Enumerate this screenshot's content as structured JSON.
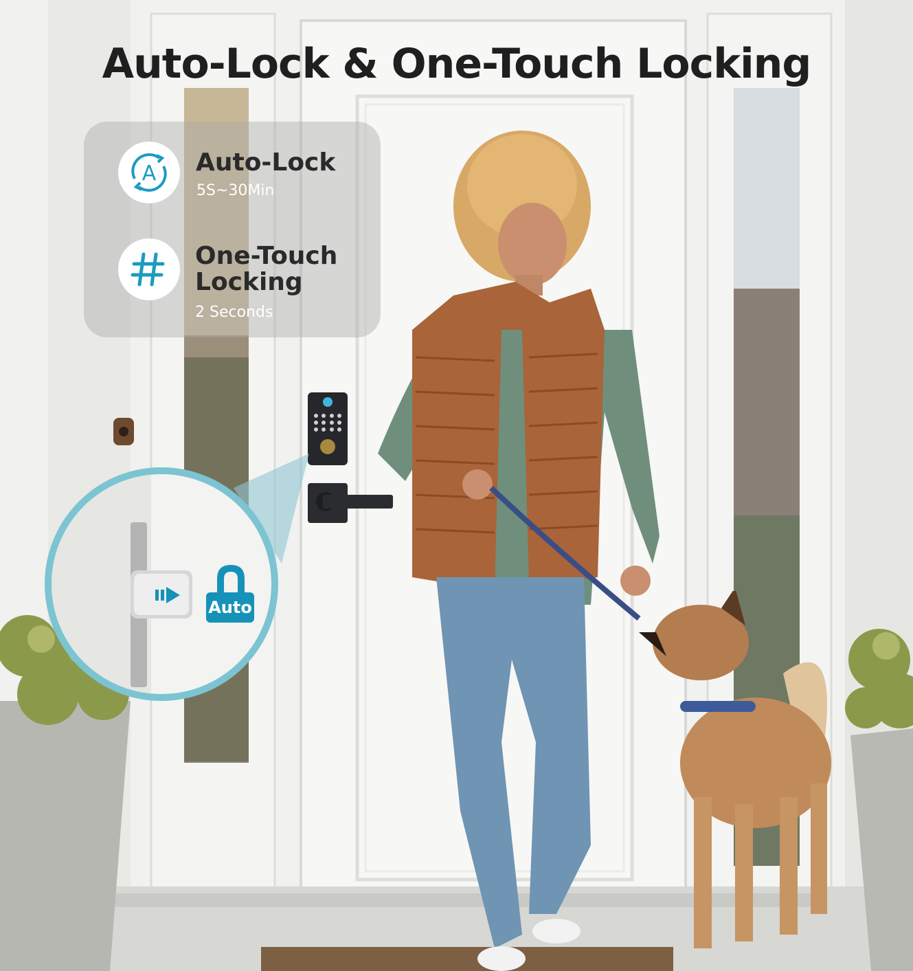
{
  "title": "Auto-Lock & One-Touch Locking",
  "features": [
    {
      "icon": "auto-lock-icon",
      "title": "Auto-Lock",
      "subtitle": "5S~30Min"
    },
    {
      "icon": "hash-icon",
      "title_line1": "One-Touch",
      "title_line2": "Locking",
      "subtitle": "2 Seconds"
    }
  ],
  "inset": {
    "badge_label": "Auto"
  },
  "colors": {
    "accent": "#1692b8",
    "title": "#1f1f1f",
    "vest": "#a9643a",
    "sweater": "#6f8f7c",
    "jeans": "#6f94b4",
    "door": "#f7f7f5"
  }
}
